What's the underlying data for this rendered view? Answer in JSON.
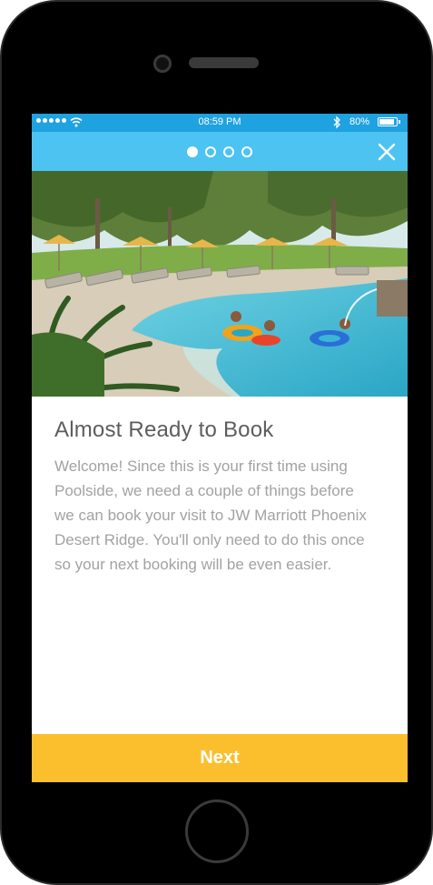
{
  "status_bar": {
    "time": "08:59 PM",
    "battery": "80%",
    "battery_level": 0.8,
    "icons": [
      "signal-dots-icon",
      "wifi-icon",
      "bluetooth-icon",
      "battery-icon"
    ]
  },
  "header": {
    "page_count": 4,
    "active_page": 1,
    "close_icon": "close-icon",
    "color": "#4cc3f1"
  },
  "status_color": "#1fa2e0",
  "content": {
    "title": "Almost Ready to Book",
    "body": "Welcome! Since this is your first time using Poolside, we need a couple of things before we can book your visit to JW Marriott Phoenix Desert Ridge. You'll only need to do this once so your next booking will be even easier."
  },
  "footer": {
    "next_label": "Next",
    "color": "#fbbf2e"
  }
}
